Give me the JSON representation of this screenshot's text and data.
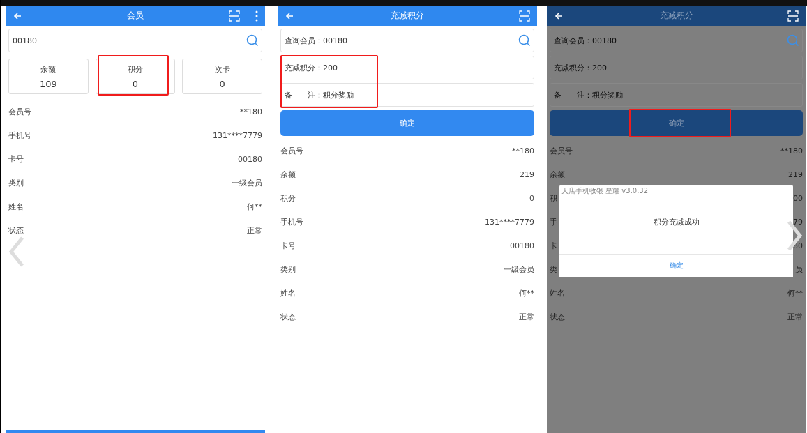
{
  "panels": [
    {
      "kind": "member",
      "dimmed": false,
      "title": "会员",
      "has_menu": true,
      "search": {
        "value": "00180"
      },
      "cards": [
        {
          "label": "余额",
          "value": "109",
          "highlighted": false
        },
        {
          "label": "积分",
          "value": "0",
          "highlighted": true
        },
        {
          "label": "次卡",
          "value": "0",
          "highlighted": false
        }
      ],
      "rows": [
        {
          "label": "会员号",
          "value": "**180"
        },
        {
          "label": "手机号",
          "value": "131****7779"
        },
        {
          "label": "卡号",
          "value": "00180"
        },
        {
          "label": "类别",
          "value": "一级会员"
        },
        {
          "label": "姓名",
          "value": "何**"
        },
        {
          "label": "状态",
          "value": "正常"
        }
      ]
    },
    {
      "kind": "adjust",
      "dimmed": false,
      "title": "充减积分",
      "fields": [
        {
          "kind": "search",
          "label": "查询会员：",
          "value": "00180",
          "highlighted": false
        },
        {
          "kind": "text",
          "label": "充减积分：",
          "value": "200",
          "highlighted": true
        },
        {
          "kind": "text",
          "label": "备　　注：",
          "value": "积分奖励",
          "highlighted": true
        }
      ],
      "submit": {
        "label": "确定"
      },
      "rows": [
        {
          "label": "会员号",
          "value": "**180"
        },
        {
          "label": "余额",
          "value": "219"
        },
        {
          "label": "积分",
          "value": "0"
        },
        {
          "label": "手机号",
          "value": "131****7779"
        },
        {
          "label": "卡号",
          "value": "00180"
        },
        {
          "label": "类别",
          "value": "一级会员"
        },
        {
          "label": "姓名",
          "value": "何**"
        },
        {
          "label": "状态",
          "value": "正常"
        }
      ]
    },
    {
      "kind": "adjust",
      "dimmed": true,
      "title": "充减积分",
      "fields": [
        {
          "kind": "search",
          "label": "查询会员：",
          "value": "00180",
          "highlighted": false
        },
        {
          "kind": "text",
          "label": "充减积分：",
          "value": "200",
          "highlighted": false
        },
        {
          "kind": "text",
          "label": "备　　注：",
          "value": "积分奖励",
          "highlighted": false
        }
      ],
      "submit": {
        "label": "确定",
        "highlighted": true
      },
      "rows": [
        {
          "label": "会员号",
          "value": "**180"
        },
        {
          "label": "余额",
          "value": "219"
        },
        {
          "label": "积",
          "value": "00"
        },
        {
          "label": "手",
          "value": "79"
        },
        {
          "label": "卡",
          "value": "80"
        },
        {
          "label": "类",
          "value": "员"
        },
        {
          "label": "姓名",
          "value": "何**"
        },
        {
          "label": "状态",
          "value": "正常"
        }
      ],
      "dialog": {
        "title": "天店手机收银 星耀 v3.0.32",
        "message": "积分充减成功",
        "button": "确定"
      }
    }
  ]
}
